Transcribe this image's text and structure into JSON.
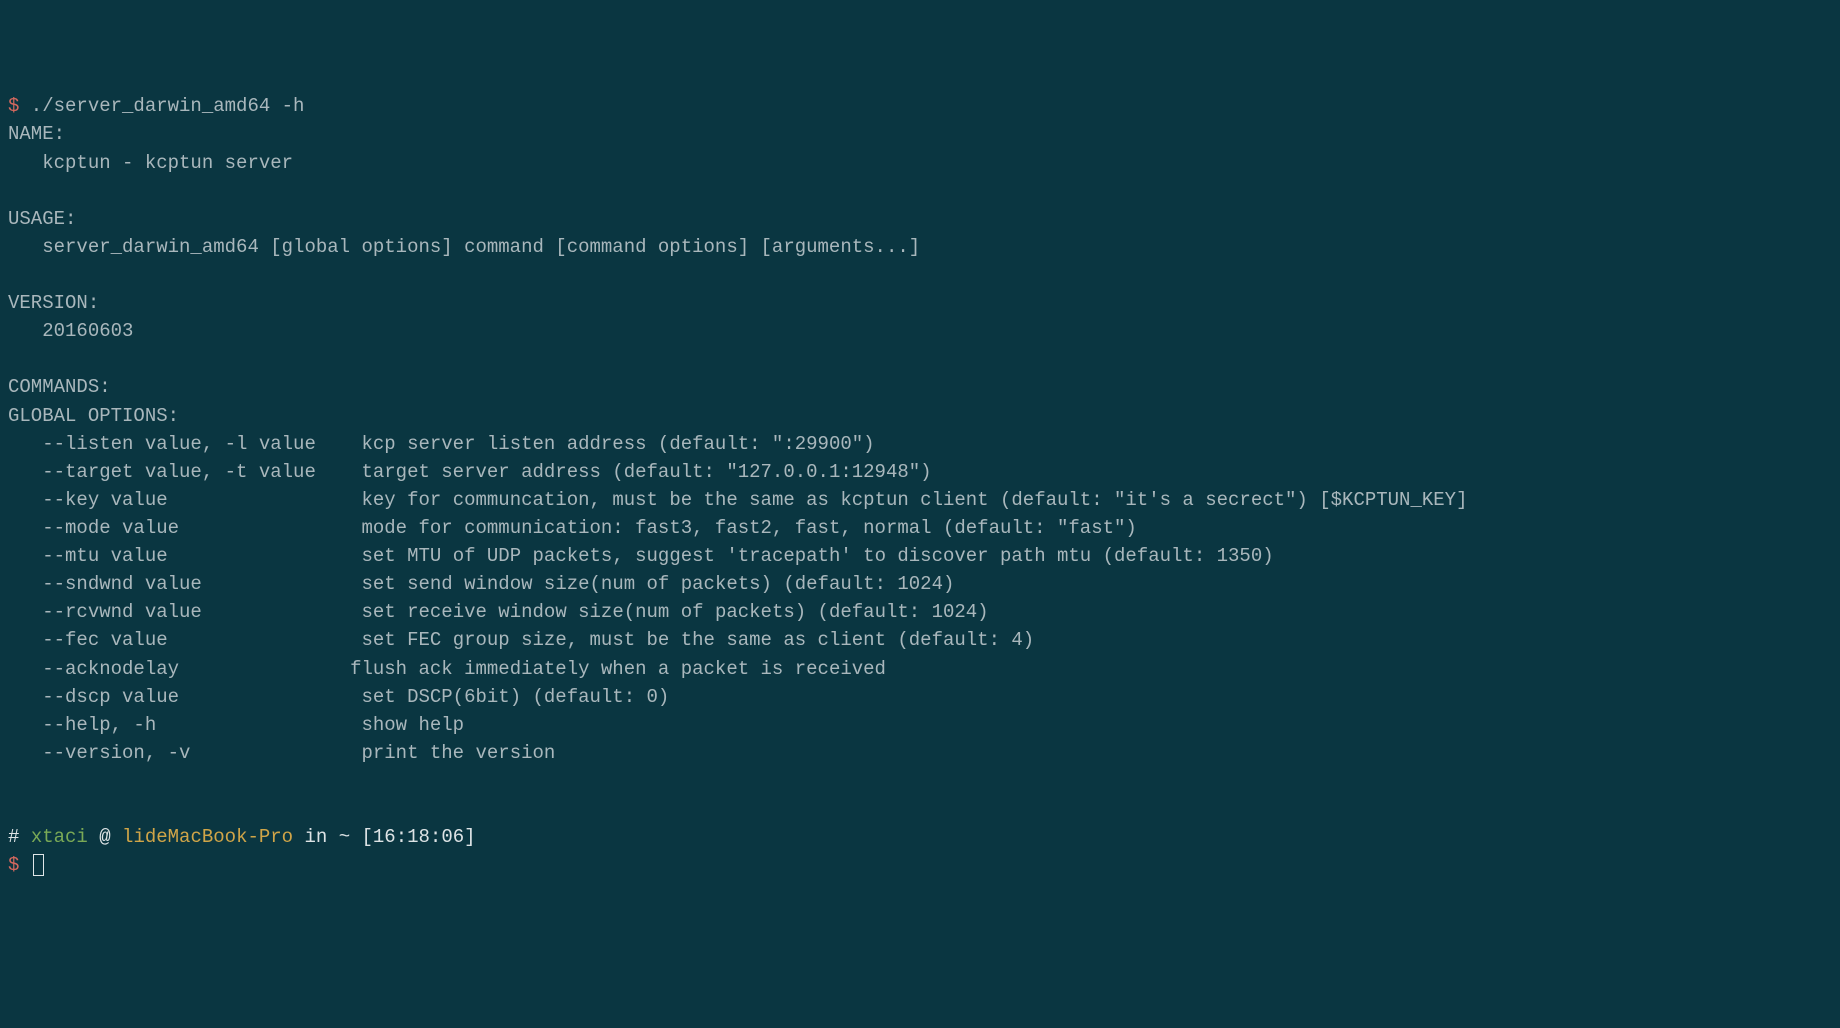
{
  "line1": {
    "prompt": "$",
    "cmd": " ./server_darwin_amd64 -h"
  },
  "name_header": "NAME:",
  "name_body": "   kcptun - kcptun server",
  "usage_header": "USAGE:",
  "usage_body": "   server_darwin_amd64 [global options] command [command options] [arguments...]",
  "version_header": "VERSION:",
  "version_body": "   20160603",
  "commands_header": "COMMANDS:",
  "globals_header": "GLOBAL OPTIONS:",
  "options": [
    {
      "flag": "   --listen value, -l value",
      "desc": "kcp server listen address (default: \":29900\")"
    },
    {
      "flag": "   --target value, -t value",
      "desc": "target server address (default: \"127.0.0.1:12948\")"
    },
    {
      "flag": "   --key value",
      "desc": "key for communcation, must be the same as kcptun client (default: \"it's a secrect\") [$KCPTUN_KEY]"
    },
    {
      "flag": "   --mode value",
      "desc": "mode for communication: fast3, fast2, fast, normal (default: \"fast\")"
    },
    {
      "flag": "   --mtu value",
      "desc": "set MTU of UDP packets, suggest 'tracepath' to discover path mtu (default: 1350)"
    },
    {
      "flag": "   --sndwnd value",
      "desc": "set send window size(num of packets) (default: 1024)"
    },
    {
      "flag": "   --rcvwnd value",
      "desc": "set receive window size(num of packets) (default: 1024)"
    },
    {
      "flag": "   --fec value",
      "desc": "set FEC group size, must be the same as client (default: 4)"
    },
    {
      "flag": "   --acknodelay",
      "desc": "flush ack immediately when a packet is received"
    },
    {
      "flag": "   --dscp value",
      "desc": "set DSCP(6bit) (default: 0)"
    },
    {
      "flag": "   --help, -h",
      "desc": "show help"
    },
    {
      "flag": "   --version, -v",
      "desc": "print the version"
    }
  ],
  "ps1": {
    "hash": "#",
    "user": "xtaci",
    "at": " @ ",
    "host": "lideMacBook-Pro",
    "rest_a": " in ",
    "path": "~",
    "rest_b": " [",
    "time": "16:18:06",
    "rest_c": "]"
  },
  "final_prompt": "$"
}
